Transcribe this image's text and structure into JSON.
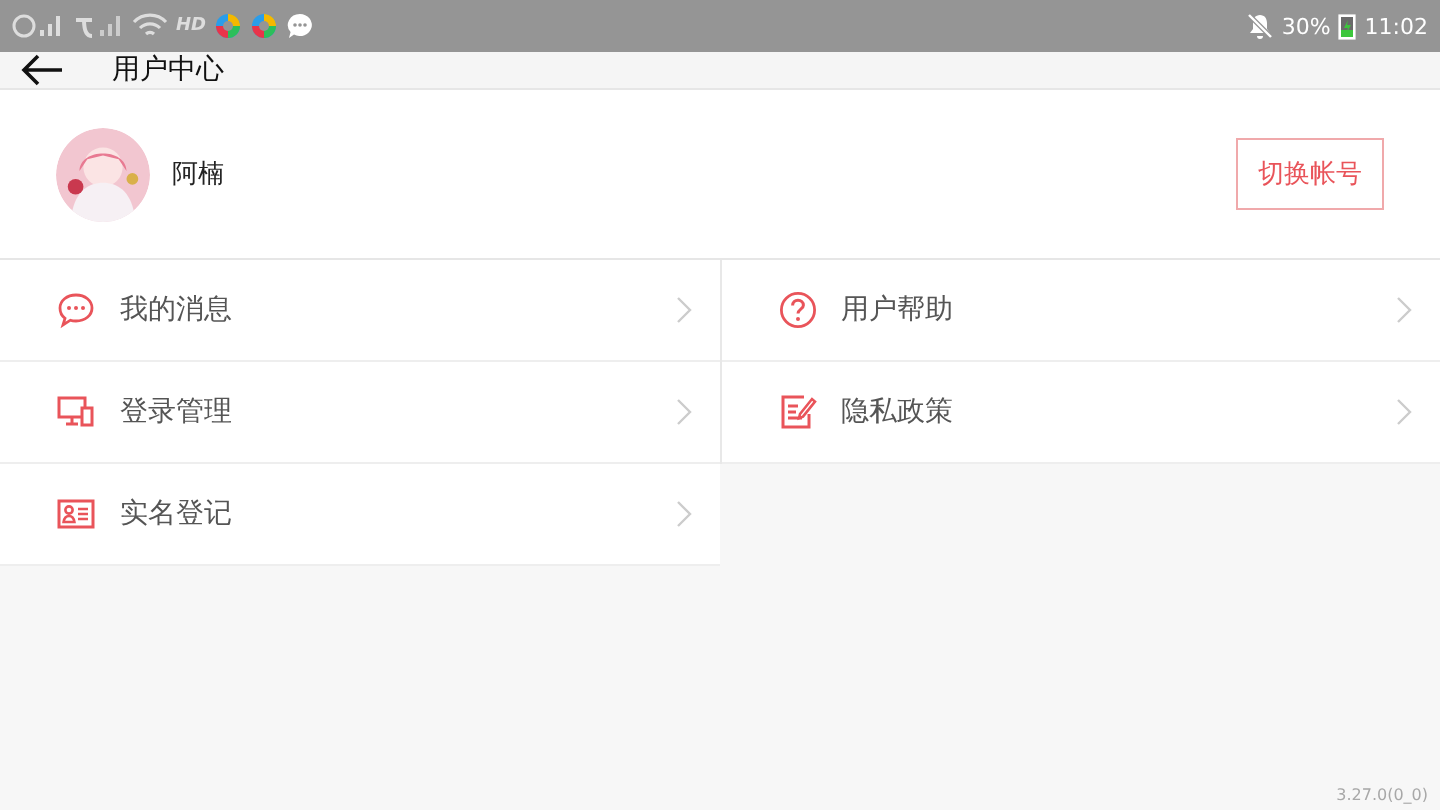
{
  "status_bar": {
    "network_label": "HD",
    "battery_percent": "30%",
    "time": "11:02"
  },
  "header": {
    "title": "用户中心"
  },
  "profile": {
    "name": "阿楠",
    "switch_button": "切换帐号"
  },
  "menu_columns": [
    [
      {
        "kind": "message",
        "label": "我的消息"
      },
      {
        "kind": "device",
        "label": "登录管理"
      },
      {
        "kind": "idcard",
        "label": "实名登记"
      }
    ],
    [
      {
        "kind": "help",
        "label": "用户帮助"
      },
      {
        "kind": "policy",
        "label": "隐私政策"
      }
    ]
  ],
  "version": "3.27.0(0_0)"
}
